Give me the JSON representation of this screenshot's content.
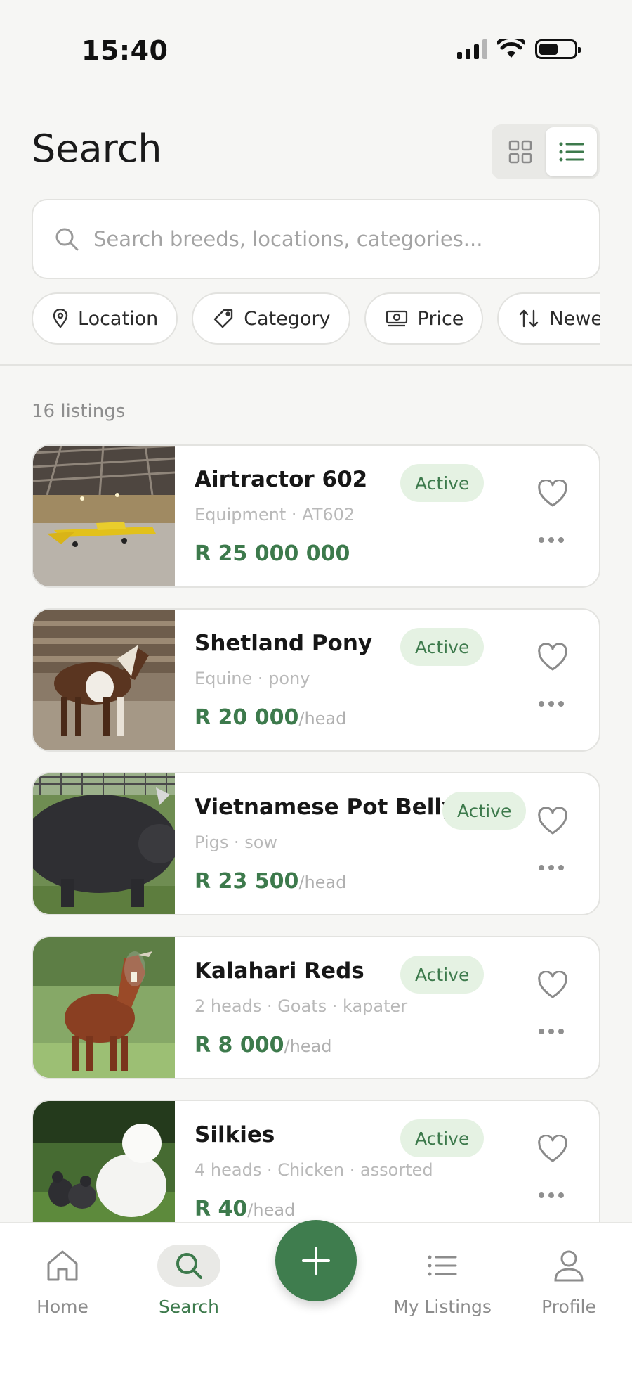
{
  "status_bar": {
    "time": "15:40"
  },
  "header": {
    "title": "Search",
    "view_modes": [
      {
        "name": "grid",
        "icon": "grid-icon",
        "active": false
      },
      {
        "name": "list",
        "icon": "list-icon",
        "active": true
      }
    ]
  },
  "search": {
    "placeholder": "Search breeds, locations, categories...",
    "value": ""
  },
  "filters": [
    {
      "label": "Location",
      "icon": "map-pin-icon"
    },
    {
      "label": "Category",
      "icon": "tag-icon"
    },
    {
      "label": "Price",
      "icon": "banknote-icon"
    },
    {
      "label": "Newest first",
      "icon": "sort-icon"
    }
  ],
  "results": {
    "count_label": "16 listings"
  },
  "listings": [
    {
      "title": "Airtractor 602",
      "subtitle": "Equipment · AT602",
      "price": "R 25 000 000",
      "unit": "",
      "status": "Active",
      "image": "aircraft-hangar-photo"
    },
    {
      "title": "Shetland Pony",
      "subtitle": "Equine · pony",
      "price": "R 20 000",
      "unit": "/head",
      "status": "Active",
      "image": "pony-photo"
    },
    {
      "title": "Vietnamese Pot Belly",
      "subtitle": "Pigs · sow",
      "price": "R 23 500",
      "unit": "/head",
      "status": "Active",
      "image": "pig-photo"
    },
    {
      "title": "Kalahari Reds",
      "subtitle": "2 heads · Goats · kapater",
      "price": "R 8 000",
      "unit": "/head",
      "status": "Active",
      "image": "goat-photo"
    },
    {
      "title": "Silkies",
      "subtitle": "4 heads · Chicken · assorted",
      "price": "R 40",
      "unit": "/head",
      "status": "Active",
      "image": "chicken-photo"
    }
  ],
  "bottom_nav": [
    {
      "label": "Home",
      "icon": "home-icon",
      "active": false
    },
    {
      "label": "Search",
      "icon": "search-icon",
      "active": true
    },
    {
      "label": "My Listings",
      "icon": "list-icon",
      "active": false
    },
    {
      "label": "Profile",
      "icon": "user-icon",
      "active": false
    }
  ],
  "fab": {
    "icon": "plus-icon"
  },
  "colors": {
    "accent": "#3d7a4c",
    "badge_bg": "#e5f2e3",
    "background": "#f6f6f4"
  }
}
